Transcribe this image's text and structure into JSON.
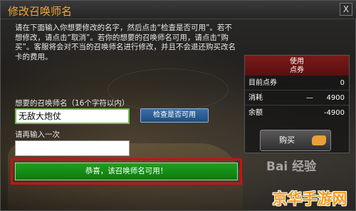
{
  "window": {
    "title": "修改召唤师名",
    "close_glyph": "X"
  },
  "description": "请在下面输入你想要修改的名字，然后点击“检查是否可用”。若不想修改，请点击“取消”。若你的想要的召唤师名可用，请点击“购买”。客服将会对不当的召唤师名进行修改，并且不会退还购买改名卡的费用。",
  "points_panel": {
    "header_line1": "使用",
    "header_line2": "点券",
    "rows": [
      {
        "label": "目前点券",
        "dash": "",
        "value": "0"
      },
      {
        "label": "消耗",
        "dash": "—",
        "value": "4900"
      },
      {
        "label": "余额",
        "dash": "",
        "value": "-4900"
      }
    ],
    "buy_label": "购买",
    "buy_icon": "hand-icon"
  },
  "form": {
    "name_label": "想要的召唤师名（16个字符以内）",
    "name_value": "无敌大炮仗",
    "check_button": "检查是否可用",
    "confirm_label": "请再输入一次",
    "confirm_value": ""
  },
  "status": {
    "message": "恭喜，该召唤师名可用！",
    "color": "#1a9a1a",
    "highlight_color": "#cc1010"
  },
  "watermarks": {
    "baidu": "Bai 经验",
    "site": "京华手游网"
  }
}
